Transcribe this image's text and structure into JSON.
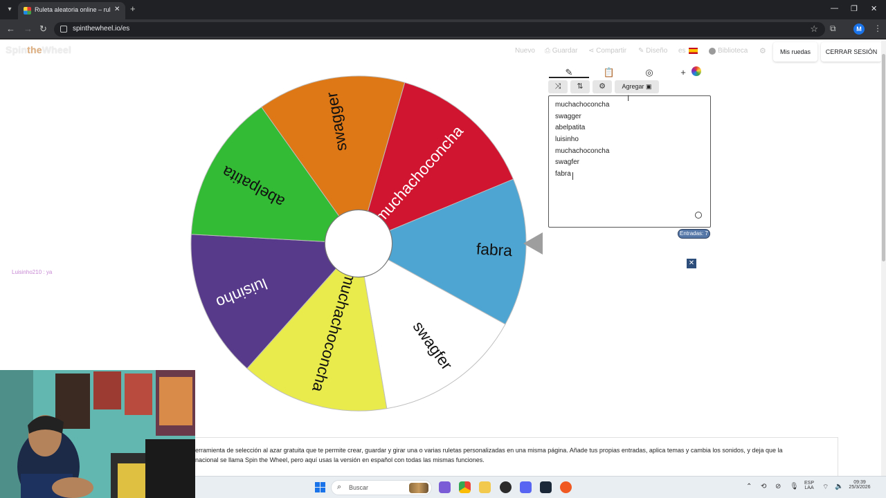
{
  "browser": {
    "tab_title": "Ruleta aleatoria online – ruleta",
    "url": "spinthewheel.io/es",
    "profile_initial": "M"
  },
  "site": {
    "logo_left": "Spin",
    "logo_mid": "the",
    "logo_right": "Wheel",
    "nav": {
      "new": "Nuevo",
      "save": "Guardar",
      "share": "Compartir",
      "design": "Diseño",
      "lang": "es",
      "library": "Biblioteca",
      "my_wheels": "Mis ruedas",
      "logout": "CERRAR SESIÓN"
    }
  },
  "wheel": {
    "segments": [
      {
        "label": "muchachoconcha",
        "color": "#cf1530",
        "text_color": "#ffffff"
      },
      {
        "label": "fabra",
        "color": "#4ea5d1",
        "text_color": "#111111"
      },
      {
        "label": "swagfer",
        "color": "#ffffff",
        "text_color": "#111111"
      },
      {
        "label": "muchachoconcha",
        "color": "#e8eb4b",
        "text_color": "#111111"
      },
      {
        "label": "luisinho",
        "color": "#573a89",
        "text_color": "#ffffff"
      },
      {
        "label": "abelpatita",
        "color": "#33bb35",
        "text_color": "#111111"
      },
      {
        "label": "swagger",
        "color": "#de7715",
        "text_color": "#111111"
      }
    ]
  },
  "editor": {
    "add_label": "Agregar",
    "entries": [
      "muchachoconcha",
      "swagger",
      "abelpatita",
      "luisinho",
      "muchachoconcha",
      "swagfer",
      "fabra"
    ],
    "count_label": "Entradas: 7"
  },
  "chat": {
    "line": "Luisinho210 : ya"
  },
  "description": {
    "line1": "erramienta de selección al azar gratuita que te permite crear, guardar y girar una o varias ruletas personalizadas en una misma página. Añade tus propias entradas, aplica temas y cambia los sonidos, y deja que la",
    "line2": "nacional se llama Spin the Wheel, pero aquí usas la versión en español con todas las mismas funciones."
  },
  "taskbar": {
    "search_placeholder": "Buscar",
    "lang_top": "ESP",
    "lang_bottom": "LAA",
    "time": "09:39",
    "date": "25/3/2026"
  }
}
